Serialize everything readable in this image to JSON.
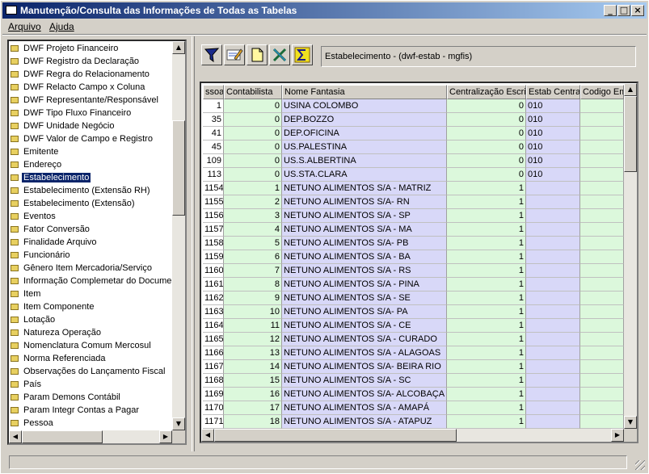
{
  "window": {
    "title": "Manutenção/Consulta das Informações de Todas as Tabelas",
    "minimize": "_",
    "maximize": "□",
    "close": "×"
  },
  "menu": {
    "arquivo": "Arquivo",
    "ajuda": "Ajuda"
  },
  "tree": {
    "items": [
      "DWF Projeto Financeiro",
      "DWF Registro da Declaração",
      "DWF Regra do Relacionamento",
      "DWF Relacto Campo x Coluna",
      "DWF Representante/Responsável",
      "DWF Tipo Fluxo Financeiro",
      "DWF Unidade Negócio",
      "DWF Valor de Campo e Registro",
      "Emitente",
      "Endereço",
      "Estabelecimento",
      "Estabelecimento  (Extensão RH)",
      "Estabelecimento (Extensão)",
      "Eventos",
      "Fator Conversão",
      "Finalidade Arquivo",
      "Funcionário",
      "Gênero Item Mercadoria/Serviço",
      "Informação Complemetar do Documento",
      "Item",
      "Item Componente",
      "Lotação",
      "Natureza Operação",
      "Nomenclatura Comum Mercosul",
      "Norma Referenciada",
      "Observações do Lançamento Fiscal",
      "País",
      "Param Demons Contábil",
      "Param Integr Contas a Pagar",
      "Pessoa"
    ],
    "selected_index": 10
  },
  "info": {
    "text": "Estabelecimento - (dwf-estab - mgfis)"
  },
  "grid": {
    "columns": [
      "ssoa",
      "Contabilista",
      "Nome Fantasia",
      "Centralização Escrit",
      "Estab Central",
      "Codigo Emp"
    ],
    "rows": [
      [
        "1",
        "0",
        "USINA COLOMBO",
        "0",
        "010",
        ""
      ],
      [
        "35",
        "0",
        "DEP.BOZZO",
        "0",
        "010",
        ""
      ],
      [
        "41",
        "0",
        "DEP.OFICINA",
        "0",
        "010",
        ""
      ],
      [
        "45",
        "0",
        "US.PALESTINA",
        "0",
        "010",
        ""
      ],
      [
        "109",
        "0",
        "US.S.ALBERTINA",
        "0",
        "010",
        ""
      ],
      [
        "113",
        "0",
        "US.STA.CLARA",
        "0",
        "010",
        ""
      ],
      [
        "1154",
        "1",
        "NETUNO ALIMENTOS S/A - MATRIZ",
        "1",
        "",
        ""
      ],
      [
        "1155",
        "2",
        "NETUNO ALIMENTOS S/A- RN",
        "1",
        "",
        ""
      ],
      [
        "1156",
        "3",
        "NETUNO ALIMENTOS S/A - SP",
        "1",
        "",
        ""
      ],
      [
        "1157",
        "4",
        "NETUNO ALIMENTOS S/A - MA",
        "1",
        "",
        ""
      ],
      [
        "1158",
        "5",
        "NETUNO ALIMENTOS S/A- PB",
        "1",
        "",
        ""
      ],
      [
        "1159",
        "6",
        "NETUNO ALIMENTOS S/A - BA",
        "1",
        "",
        ""
      ],
      [
        "1160",
        "7",
        "NETUNO ALIMENTOS S/A - RS",
        "1",
        "",
        ""
      ],
      [
        "1161",
        "8",
        "NETUNO ALIMENTOS S/A - PINA",
        "1",
        "",
        ""
      ],
      [
        "1162",
        "9",
        "NETUNO ALIMENTOS S/A - SE",
        "1",
        "",
        ""
      ],
      [
        "1163",
        "10",
        "NETUNO ALIMENTOS S/A- PA",
        "1",
        "",
        ""
      ],
      [
        "1164",
        "11",
        "NETUNO ALIMENTOS S/A - CE",
        "1",
        "",
        ""
      ],
      [
        "1165",
        "12",
        "NETUNO ALIMENTOS S/A - CURADO",
        "1",
        "",
        ""
      ],
      [
        "1166",
        "13",
        "NETUNO ALIMENTOS S/A - ALAGOAS",
        "1",
        "",
        ""
      ],
      [
        "1167",
        "14",
        "NETUNO ALIMENTOS S/A- BEIRA RIO",
        "1",
        "",
        ""
      ],
      [
        "1168",
        "15",
        "NETUNO ALIMENTOS S/A - SC",
        "1",
        "",
        ""
      ],
      [
        "1169",
        "16",
        "NETUNO ALIMENTOS S/A-  ALCOBAÇA",
        "1",
        "",
        ""
      ],
      [
        "1170",
        "17",
        "NETUNO ALIMENTOS S/A -  AMAPÁ",
        "1",
        "",
        ""
      ],
      [
        "1171",
        "18",
        "NETUNO ALIMENTOS S/A - ATAPUZ",
        "1",
        "",
        ""
      ]
    ]
  },
  "scroll": {
    "up": "▲",
    "down": "▼",
    "left": "◀",
    "right": "▶"
  },
  "toolbar": {
    "icons": [
      "filter-icon",
      "edit-icon",
      "new-document-icon",
      "excel-icon",
      "sum-icon"
    ]
  },
  "colors": {
    "title_start": "#0a246a",
    "title_end": "#a6caf0",
    "selection": "#0a246a",
    "cell_blue": "#d8d8f8",
    "cell_green": "#dcf8dc"
  }
}
